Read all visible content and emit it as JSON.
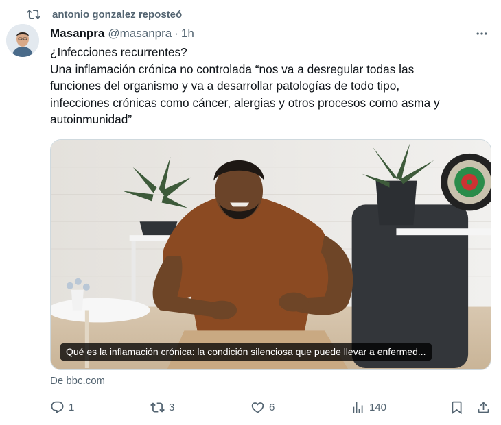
{
  "repost": {
    "label": "antonio gonzalez reposteó"
  },
  "author": {
    "name": "Masanpra",
    "handle": "@masanpra",
    "separator": "·",
    "time": "1h"
  },
  "tweet": {
    "lines": [
      "¿Infecciones recurrentes?",
      "Una inflamación crónica no controlada “nos va a desregular todas las",
      "funciones del organismo y va a desarrollar patologías de todo tipo,",
      "infecciones crónicas como cáncer, alergias y otros procesos como asma y",
      "autoinmunidad”"
    ]
  },
  "card": {
    "caption": "Qué es la inflamación crónica: la condición silenciosa que puede llevar a enfermed...",
    "source": "De bbc.com"
  },
  "actions": {
    "reply": {
      "icon": "reply-icon",
      "count": "1"
    },
    "repost": {
      "icon": "repost-icon",
      "count": "3"
    },
    "like": {
      "icon": "heart-icon",
      "count": "6"
    },
    "views": {
      "icon": "views-icon",
      "count": "140"
    },
    "bookmark": {
      "icon": "bookmark-icon"
    },
    "share": {
      "icon": "share-icon"
    }
  },
  "colors": {
    "text": "#0f1419",
    "secondary": "#536471",
    "border": "#cfd9de",
    "caption_bg": "#000000"
  }
}
